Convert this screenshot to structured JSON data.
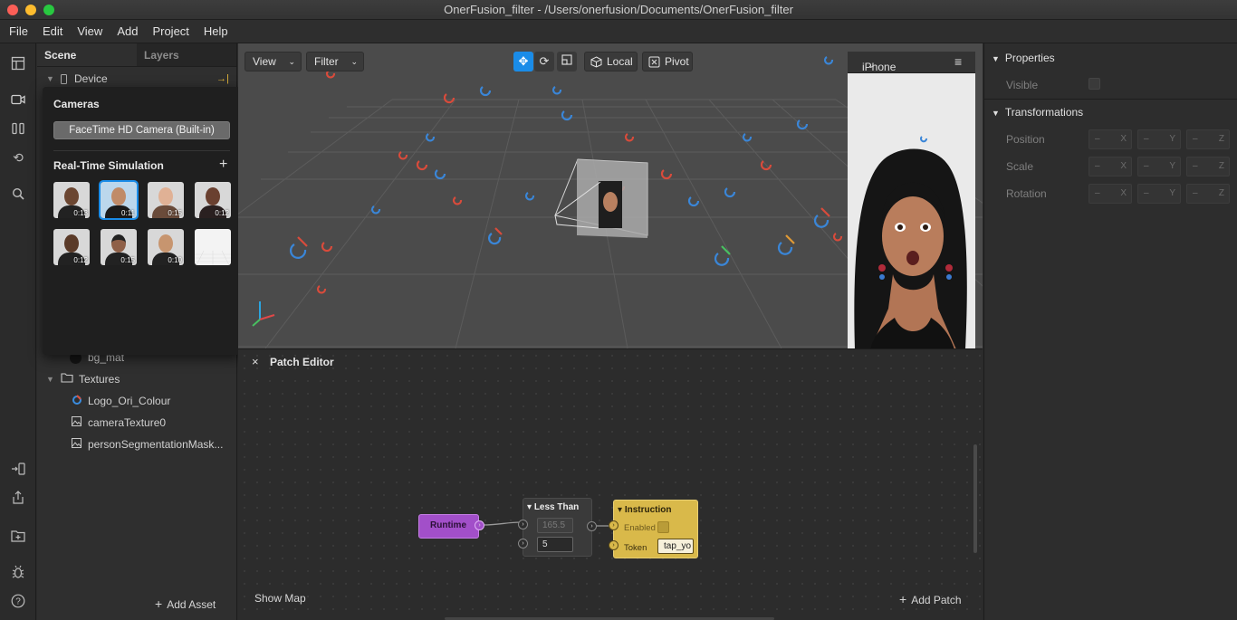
{
  "window": {
    "title": "OnerFusion_filter - /Users/onerfusion/Documents/OnerFusion_filter"
  },
  "menu": [
    "File",
    "Edit",
    "View",
    "Add",
    "Project",
    "Help"
  ],
  "scene": {
    "tabs": {
      "scene": "Scene",
      "layers": "Layers"
    },
    "device": "Device",
    "hidden_material": "bg_mat",
    "textures_folder": "Textures",
    "textures": [
      "Logo_Ori_Colour",
      "cameraTexture0",
      "personSegmentationMask..."
    ],
    "add_asset": "Add Asset"
  },
  "cameras_popup": {
    "title": "Cameras",
    "camera_button": "FaceTime HD Camera (Built-in)",
    "simulation_title": "Real-Time Simulation",
    "add": "+",
    "videos": [
      "0:13",
      "0:11",
      "0:15",
      "0:12",
      "0:12",
      "0:15",
      "0:10",
      ""
    ]
  },
  "viewport": {
    "view_btn": "View",
    "filter_btn": "Filter",
    "local_btn": "Local",
    "pivot_btn": "Pivot"
  },
  "simulator": {
    "device": "iPhone X"
  },
  "patch_editor": {
    "title": "Patch Editor",
    "close": "×",
    "show_map": "Show Map",
    "add_patch": "Add Patch",
    "runtime": "Runtime",
    "less_than": {
      "title": "Less Than",
      "input1": "165.5",
      "input2": "5"
    },
    "instruction": {
      "title": "Instruction",
      "enabled_label": "Enabled",
      "token_label": "Token",
      "token_value": "tap_yo"
    }
  },
  "properties": {
    "title": "Properties",
    "visible_label": "Visible",
    "transformations_title": "Transformations",
    "rows": [
      {
        "label": "Position",
        "x": "–",
        "y": "–",
        "z": "–"
      },
      {
        "label": "Scale",
        "x": "–",
        "y": "–",
        "z": "–"
      },
      {
        "label": "Rotation",
        "x": "–",
        "y": "–",
        "z": "–"
      }
    ],
    "axes": [
      "X",
      "Y",
      "Z"
    ]
  },
  "colors": {
    "accent": "#1a8ce8",
    "runtime_node": "#a24fc9",
    "instruction_node": "#d9b94a"
  }
}
